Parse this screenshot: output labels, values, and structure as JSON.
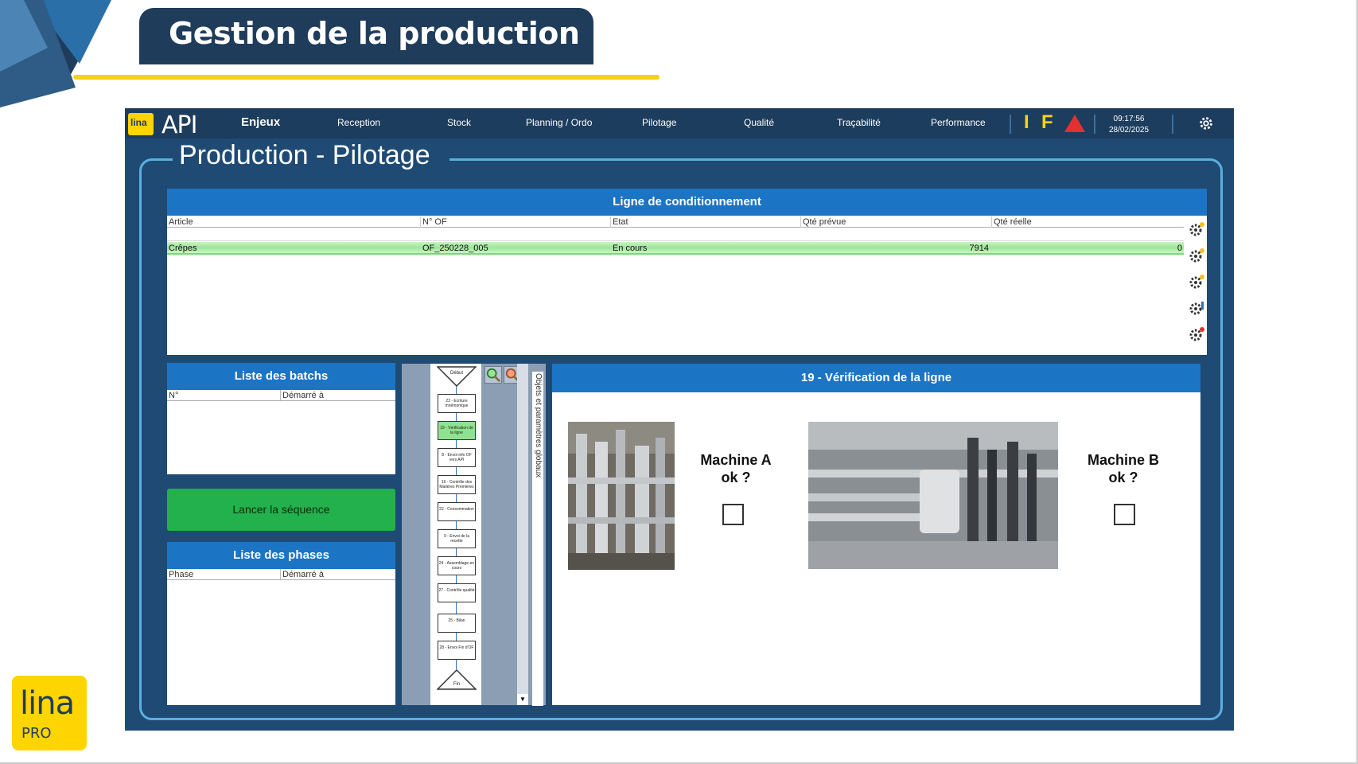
{
  "slide": {
    "title": "Gestion de la production"
  },
  "brand": {
    "lina_word": "lina",
    "pro_word": "PRO",
    "api_logo_text": "API",
    "small_logo_text": "lina"
  },
  "topbar": {
    "nav": [
      "Enjeux",
      "Reception",
      "Stock",
      "Planning / Ordo",
      "Pilotage",
      "Qualité",
      "Traçabilité",
      "Performance"
    ],
    "indicator_i": "I",
    "indicator_f": "F",
    "time": "09:17:56",
    "date": "28/02/2025"
  },
  "page": {
    "title": "Production - Pilotage"
  },
  "line_panel": {
    "title": "Ligne de conditionnement",
    "columns": [
      "Article",
      "N° OF",
      "Etat",
      "Qté prévue",
      "Qté réelle"
    ],
    "row": {
      "article": "Crêpes",
      "of": "OF_250228_005",
      "etat": "En cours",
      "qte_prevue": "7914",
      "qte_reelle": "0"
    }
  },
  "batch_panel": {
    "title": "Liste des batchs",
    "columns": [
      "N°",
      "Démarré à"
    ]
  },
  "launch_button": "Lancer la séquence",
  "phase_panel": {
    "title": "Liste des phases",
    "columns": [
      "Phase",
      "Démarré à"
    ]
  },
  "flow": {
    "side_label": "Objets et paramètres globaux",
    "start": "Début",
    "end": "Fin",
    "steps": [
      {
        "label": "23 - Ecriture mnémonique",
        "active": false
      },
      {
        "label": "19 - Vérification de la ligne",
        "active": true
      },
      {
        "label": "8 - Envoi info OF vers API",
        "active": false
      },
      {
        "label": "16 - Contrôle des Matières Premières",
        "active": false
      },
      {
        "label": "22 - Consommation",
        "active": false
      },
      {
        "label": "9 - Envoi de la recette",
        "active": false
      },
      {
        "label": "24 - Assemblage en cours",
        "active": false
      },
      {
        "label": "27 - Contrôle qualité",
        "active": false
      },
      {
        "label": "25 - Bilan",
        "active": false
      },
      {
        "label": "28 - Envoi Fin d'OF",
        "active": false
      }
    ]
  },
  "verif_panel": {
    "title": "19 - Vérification de la ligne",
    "machine_a": {
      "line1": "Machine A",
      "line2": "ok ?"
    },
    "machine_b": {
      "line1": "Machine B",
      "line2": "ok ?"
    }
  },
  "colors": {
    "accent_blue": "#1c74c4",
    "frame_blue": "#5ab0e0",
    "app_bg": "#1f4a73",
    "green": "#22b14c",
    "yellow": "#f3d11f"
  }
}
